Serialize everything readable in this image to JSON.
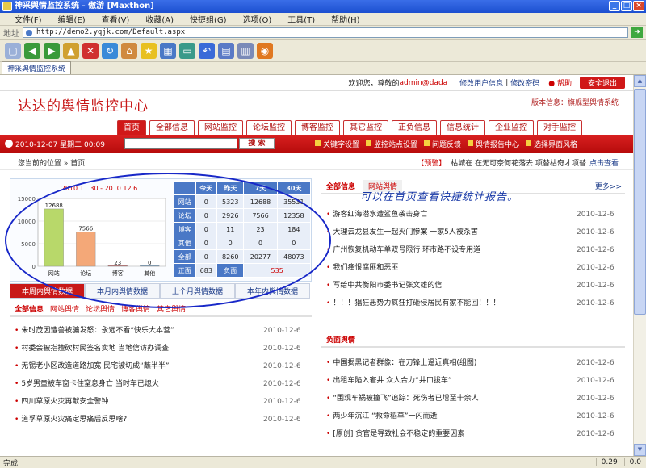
{
  "window": {
    "title": "神采舆情监控系统 - 傲游 [Maxthon]"
  },
  "menu": [
    "文件(F)",
    "编辑(E)",
    "查看(V)",
    "收藏(A)",
    "快捷组(G)",
    "选项(O)",
    "工具(T)",
    "帮助(H)"
  ],
  "address": {
    "label": "地址",
    "url": "http://demo2.yqjk.com/Default.aspx"
  },
  "browser_tab": "神采舆情监控系统",
  "topstrip": {
    "welcome": "欢迎您，尊敬的",
    "user": "admin@dada",
    "edit_profile": "修改用户信息",
    "sep": "|",
    "change_pwd": "修改密码",
    "help": "帮助",
    "logout": "安全退出"
  },
  "logo": "达达的舆情监控中心",
  "version": "版本信息：旗舰型舆情系统",
  "nav": [
    "首页",
    "全部信息",
    "网站监控",
    "论坛监控",
    "博客监控",
    "其它监控",
    "正负信息",
    "信息统计",
    "企业监控",
    "对手监控"
  ],
  "redbar": {
    "date": "2010-12-07 星期二 00:09",
    "search_btn": "搜 索",
    "links": [
      "关键字设置",
      "监控站点设置",
      "问题反馈",
      "舆情报告中心",
      "选择界面风格"
    ]
  },
  "crumb": {
    "text": "您当前的位置 » 首页",
    "warn": "【预警】",
    "ticker": "枯城在 在无可奈何花落去 项替枯奇才项替",
    "more": "点击查看"
  },
  "chart_data": {
    "type": "bar",
    "title": "2010.11.30 - 2010.12.6",
    "categories": [
      "网站",
      "论坛",
      "博客",
      "其他"
    ],
    "values": [
      12688,
      7566,
      23,
      0
    ],
    "ylim": [
      0,
      15000
    ],
    "yticks": [
      0,
      5000,
      10000,
      15000
    ],
    "colors": [
      "#b8d86a",
      "#f4a878",
      "#e05050",
      "#68a8e0"
    ]
  },
  "stats": {
    "headers": [
      "",
      "今天",
      "昨天",
      "7天",
      "30天"
    ],
    "rows": [
      {
        "label": "网站",
        "vals": [
          "0",
          "5323",
          "12688",
          "35531"
        ]
      },
      {
        "label": "论坛",
        "vals": [
          "0",
          "2926",
          "7566",
          "12358"
        ]
      },
      {
        "label": "博客",
        "vals": [
          "0",
          "11",
          "23",
          "184"
        ]
      },
      {
        "label": "其他",
        "vals": [
          "0",
          "0",
          "0",
          "0"
        ]
      },
      {
        "label": "全部",
        "vals": [
          "0",
          "8260",
          "20277",
          "48073"
        ]
      }
    ],
    "pos_label": "正面",
    "pos_val": "683",
    "neg_label": "负面",
    "neg_val": "535"
  },
  "subtabs": [
    "本周内舆情数据",
    "本月内舆情数据",
    "上个月舆情数据",
    "本年内舆情数据"
  ],
  "left_tabs": [
    "全部信息",
    "网站舆情",
    "论坛舆情",
    "博客舆情",
    "其它舆情"
  ],
  "left_news": [
    {
      "t": "朱时茂因遭兽被骗发怒：永远不看“快乐大本营”",
      "d": "2010-12-6"
    },
    {
      "t": "村委会被指擅砍村民签名卖地 当地信访办调查",
      "d": "2010-12-6"
    },
    {
      "t": "无锡老小区改造道路加宽 民宅被切成“蘸半半”",
      "d": "2010-12-6"
    },
    {
      "t": "5岁男童被车窗卡住窒息身亡 当时车已熄火",
      "d": "2010-12-6"
    },
    {
      "t": "四川草原火灾再献安全警钟",
      "d": "2010-12-6"
    },
    {
      "t": "道孚草原火灾痛定思痛后反思啥?",
      "d": "2010-12-6"
    }
  ],
  "right_tabs": {
    "active": "全部信息",
    "alt": "网站舆情",
    "more": "更多>>"
  },
  "annotation": "可以在首页查看快捷统计报告。",
  "right_news": [
    {
      "t": "游客红海潜水遭鲨鱼袭击身亡",
      "d": "2010-12-6"
    },
    {
      "t": "大理云龙县发生一起灭门惨案 一家5人被杀害",
      "d": "2010-12-6"
    },
    {
      "t": "广州恢复机动车单双号限行 环市路不设专用道",
      "d": "2010-12-6"
    },
    {
      "t": "我们痛恨腐匪和恶匪",
      "d": "2010-12-6"
    },
    {
      "t": "写给中共衡阳市委书记张文雄的信",
      "d": "2010-12-6"
    },
    {
      "t": "！！！猖狂恶势力疯狂打砸侵居民有家不能回！！！",
      "d": "2010-12-6"
    }
  ],
  "neg_title": "负面舆情",
  "neg_news": [
    {
      "t": "中国揭黑记者群像：在刀锋上逼近真相(组图)",
      "d": "2010-12-6"
    },
    {
      "t": "出租车陷入窘井 众人合力“井口拔车”",
      "d": "2010-12-6"
    },
    {
      "t": "“围观车祸被撞飞”追踪：死伤者已增至十余人",
      "d": "2010-12-6"
    },
    {
      "t": "两少年沉江 “救命稻草”一闪而逝",
      "d": "2010-12-6"
    },
    {
      "t": "[原创] 贪官是导致社会不稳定的重要因素",
      "d": "2010-12-6"
    }
  ],
  "status": {
    "text": "完成",
    "cells": [
      "0.29",
      "0.0"
    ]
  }
}
